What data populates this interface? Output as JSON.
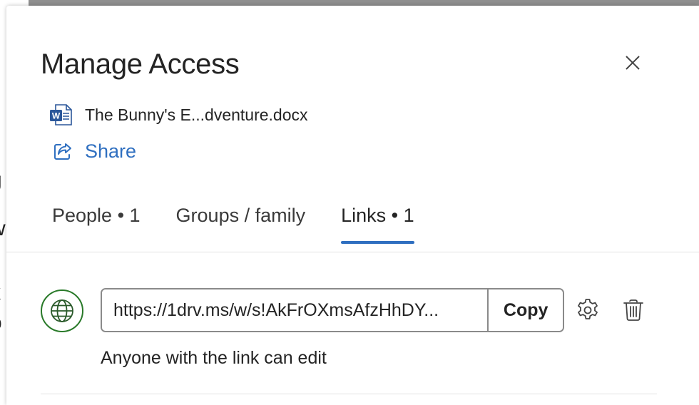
{
  "dialog": {
    "title": "Manage Access",
    "close_icon": "close-icon"
  },
  "file": {
    "icon": "word-doc-icon",
    "name": "The Bunny's E...dventure.docx"
  },
  "share": {
    "icon": "share-icon",
    "label": "Share"
  },
  "tabs": [
    {
      "label": "People • 1",
      "active": false
    },
    {
      "label": "Groups / family",
      "active": false
    },
    {
      "label": "Links • 1",
      "active": true
    }
  ],
  "link": {
    "icon": "globe-icon",
    "url": "https://1drv.ms/w/s!AkFrOXmsAfzHhDY...",
    "copy_label": "Copy",
    "settings_icon": "gear-icon",
    "delete_icon": "trash-icon",
    "permission": "Anyone with the link can edit"
  },
  "colors": {
    "accent": "#2f6fc0",
    "globe_border": "#2a7a2a",
    "word_blue": "#2b579a"
  }
}
